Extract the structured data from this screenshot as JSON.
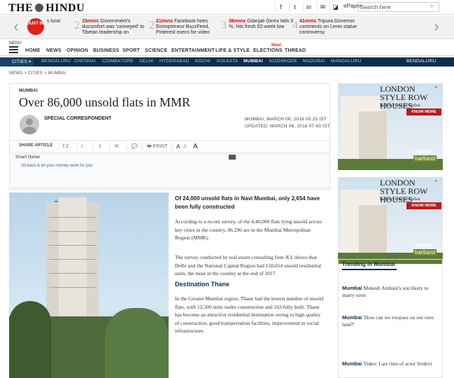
{
  "header": {
    "logo_left": "THE",
    "logo_right": "HINDU",
    "social": [
      "f",
      "t",
      "in",
      "✉",
      "◪"
    ],
    "epaper": "ePaper",
    "search_placeholder": "Search here"
  },
  "just_in": {
    "badge": "JUST IN",
    "first": "s fund",
    "items": [
      {
        "time": "15mins",
        "text": "Government's discomfort was 'conveyed' to Tibetan leadership on"
      },
      {
        "time": "21mins",
        "text": "Facebook hires Entrepreneur BuzzFeed, Pinterest execs for video content"
      },
      {
        "time": "36mins",
        "text": "Gitanjali Gems falls 5 %, hits fresh 52-week low"
      },
      {
        "time": "41mins",
        "text": "Tripura Governor comments on Lenin statue controversy"
      }
    ],
    "nums": [
      "2",
      "3",
      "4"
    ]
  },
  "menu": {
    "label": "MENU",
    "items": [
      "HOME",
      "NEWS",
      "OPINION",
      "BUSINESS",
      "SPORT",
      "SCIENCE",
      "ENTERTAINMENT",
      "LIFE & STYLE",
      "ELECTIONS",
      "THREAD"
    ],
    "new_badge": "New!"
  },
  "cities": {
    "button": "CITIES",
    "items": [
      "BENGALURU",
      "CHENNAI",
      "COIMBATORE",
      "DELHI",
      "HYDERABAD",
      "KOCHI",
      "KOLKATA",
      "MUMBAI",
      "KOZHIKODE",
      "MADURAI",
      "MANGALURU",
      "BENGALURU"
    ],
    "active": "MUMBAI"
  },
  "breadcrumb": [
    "NEWS",
    ">",
    "CITIES",
    ">",
    "MUMBAI"
  ],
  "article": {
    "kicker": "MUMBAI",
    "title": "Over 86,000 unsold flats in MMR",
    "author": "SPECIAL CORRESPONDENT",
    "date1": "MUMBAI, MARCH 06, 2018 00:25 IST",
    "date2": "UPDATED: MARCH 06, 2018 07:43 IST",
    "share_label": "SHARE ARTICLE",
    "share": [
      "f 2",
      "t",
      "⇪",
      "✉",
      "💬",
      "🖶 PRINT"
    ],
    "fonts": [
      "A",
      "A",
      "A"
    ],
    "ad_title": "Smart Owner",
    "ad_link": "Sit back & let your money work for you",
    "lead": "Of 24,000 unsold flats in Navi Mumbai, only 2,654 have been fully constructed",
    "p1": "According to a recent survey, of the 4,40,000 flats lying unsold across key cities in the country, 86,296 are in the Mumbai Metropolitan Region (MMR).",
    "p2": "The survey conducted by real estate consulting firm JLL shows that Delhi and the National Capital Region had 150,654 unsold residential units, the most in the country at the end of 2017.",
    "subhead": "Destination Thane",
    "p3": "In the Greater Mumbai region, Thane had the lowest number of unsold flats, with 12,500 units under construction and 163 fully built. Thane has become an attractive residential destination owing to high quality of construction, good transportation facilities, improvement in social infrastructure."
  },
  "side_ad": {
    "title": "LONDON STYLE ROW HOUSES",
    "subtitle": "In The Heart of Dubai",
    "button": "KNOW MORE",
    "brand": "SOBHA",
    "brand2": "hartland"
  },
  "trending": {
    "heading": "Trending in Mumbai",
    "items": [
      {
        "cat": "Mumbai",
        "text": "Mukesh Ambani's son likely to marry soon"
      },
      {
        "cat": "Mumbai",
        "text": "'How can we trespass on our own land?'"
      },
      {
        "cat": "Mumbai",
        "text": "Video: Last rites of actor Sridevi"
      }
    ]
  }
}
